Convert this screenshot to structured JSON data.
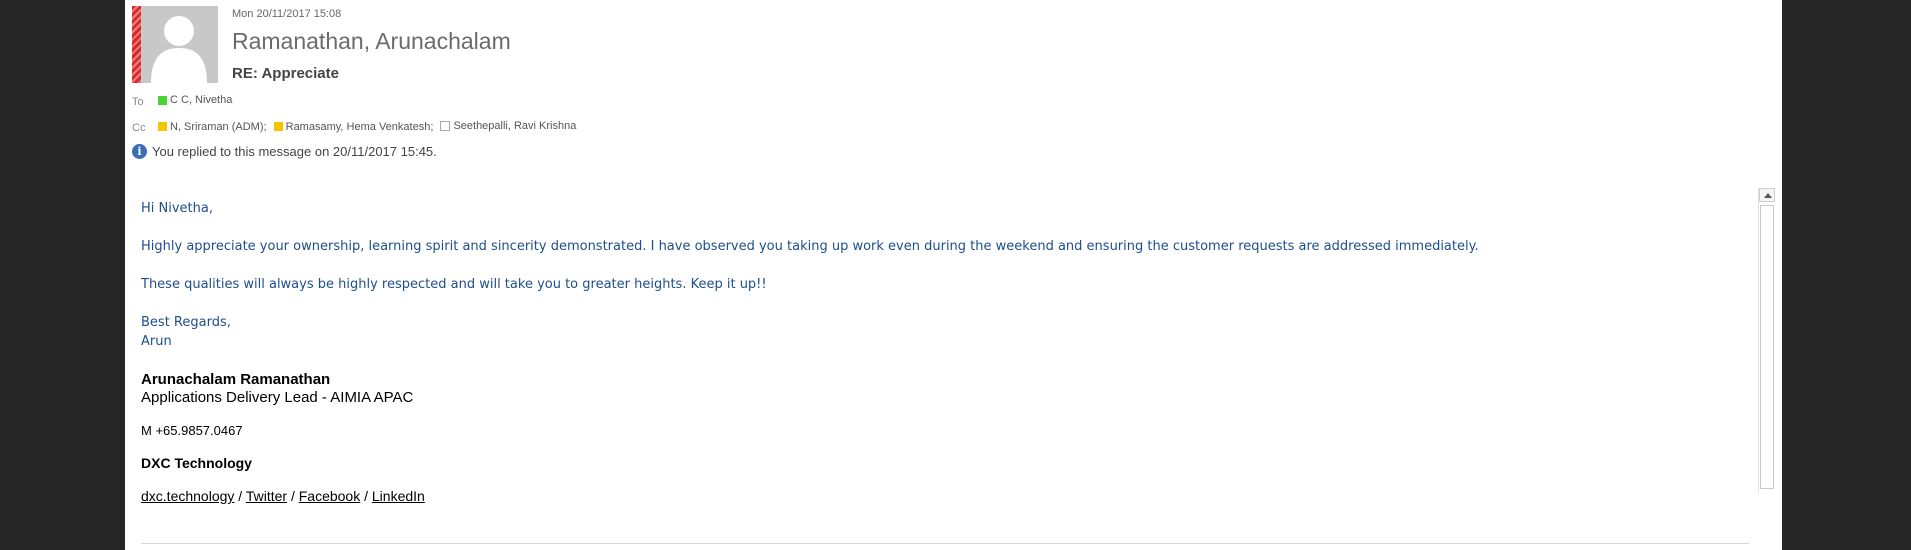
{
  "message": {
    "date": "Mon 20/11/2017 15:08",
    "sender": "Ramanathan, Arunachalam",
    "subject": "RE: Appreciate",
    "to_label": "To",
    "cc_label": "Cc",
    "to": [
      {
        "name": "C C, Nivetha",
        "presence": "green"
      }
    ],
    "cc": [
      {
        "name": "N, Sriraman (ADM);",
        "presence": "yellow"
      },
      {
        "name": "Ramasamy, Hema Venkatesh;",
        "presence": "yellow"
      },
      {
        "name": "Seethepalli, Ravi Krishna",
        "presence": "none"
      }
    ],
    "info_text": "You replied to this message on 20/11/2017 15:45."
  },
  "body": {
    "greeting": "Hi Nivetha,",
    "para1": "Highly appreciate your ownership, learning spirit and sincerity demonstrated. I have observed you taking up work even during the weekend and ensuring the customer requests are addressed immediately.",
    "para2": "These qualities will always be highly respected and will take you to greater heights. Keep it up!!",
    "closing": "Best Regards,",
    "closing_name": "Arun"
  },
  "signature": {
    "name": "Arunachalam Ramanathan",
    "role": "Applications Delivery Lead - AIMIA APAC",
    "phone": "M +65.9857.0467",
    "company": "DXC Technology",
    "links": [
      "dxc.technology",
      "Twitter",
      "Facebook",
      "LinkedIn"
    ],
    "separator": " / "
  },
  "colors": {
    "body_text": "#1f4e8c",
    "presence_green": "#4cd137",
    "presence_yellow": "#f5c400",
    "info_icon": "#3a6fb5"
  },
  "icons": {
    "avatar": "person-silhouette-icon",
    "info": "info-icon",
    "scroll_up": "scroll-up-arrow-icon"
  }
}
